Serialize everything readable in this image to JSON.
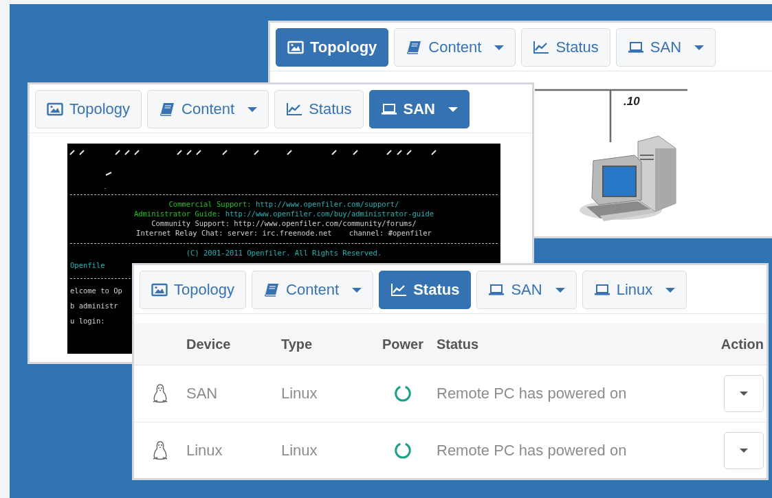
{
  "windows": [
    {
      "kind": "topology",
      "tabs": [
        {
          "label": "Topology",
          "kind": "image",
          "dropdown": false,
          "selected": true
        },
        {
          "label": "Content",
          "kind": "book",
          "dropdown": true,
          "selected": false
        },
        {
          "label": "Status",
          "kind": "chart",
          "dropdown": false,
          "selected": false
        },
        {
          "label": "SAN",
          "kind": "laptop",
          "dropdown": true,
          "selected": false
        }
      ],
      "topology": {
        "address": ".10"
      }
    },
    {
      "kind": "terminal",
      "tabs": [
        {
          "label": "Topology",
          "kind": "image",
          "dropdown": false,
          "selected": false
        },
        {
          "label": "Content",
          "kind": "book",
          "dropdown": true,
          "selected": false
        },
        {
          "label": "Status",
          "kind": "chart",
          "dropdown": false,
          "selected": false
        },
        {
          "label": "SAN",
          "kind": "laptop",
          "dropdown": true,
          "selected": true
        }
      ],
      "terminal": {
        "lines": [
          {
            "kind": "art"
          },
          {
            "kind": "rule"
          },
          {
            "kind": "center",
            "segments": [
              {
                "text": "Commercial Support: ",
                "color": "#22c322"
              },
              {
                "text": "http://www.openfiler.com/support/",
                "color": "#22b5b5"
              }
            ]
          },
          {
            "kind": "center",
            "segments": [
              {
                "text": "Administrator Guide: ",
                "color": "#22c322"
              },
              {
                "text": "http://www.openfiler.com/buy/administrator-guide",
                "color": "#22b5b5"
              }
            ]
          },
          {
            "kind": "center",
            "segments": [
              {
                "text": "Community Support: http://www.openfiler.com/community/forums/",
                "color": "#d0d0d0"
              }
            ]
          },
          {
            "kind": "center",
            "segments": [
              {
                "text": "Internet Relay Chat: server: irc.freenode.net    channel: #openfiler",
                "color": "#d0d0d0"
              }
            ]
          },
          {
            "kind": "rule"
          },
          {
            "kind": "center",
            "segments": [
              {
                "text": "(C) 2001-2011 Openfiler. All Rights Reserved.",
                "color": "#22b5b5"
              }
            ]
          },
          {
            "kind": "left",
            "segments": [
              {
                "text": "Openfile",
                "color": "#22b5b5"
              }
            ]
          },
          {
            "kind": "rule"
          },
          {
            "kind": "left",
            "segments": [
              {
                "text": "elcome to Op",
                "color": "#d0d0d0"
              }
            ]
          },
          {
            "kind": "left",
            "segments": [
              {
                "text": "b administr",
                "color": "#d0d0d0"
              }
            ]
          },
          {
            "kind": "left",
            "segments": [
              {
                "text": "u login:",
                "color": "#d0d0d0"
              }
            ]
          }
        ]
      }
    },
    {
      "kind": "devices",
      "tabs": [
        {
          "label": "Topology",
          "kind": "image",
          "dropdown": false,
          "selected": false
        },
        {
          "label": "Content",
          "kind": "book",
          "dropdown": true,
          "selected": false
        },
        {
          "label": "Status",
          "kind": "chart",
          "dropdown": false,
          "selected": true
        },
        {
          "label": "SAN",
          "kind": "laptop",
          "dropdown": true,
          "selected": false
        },
        {
          "label": "Linux",
          "kind": "laptop",
          "dropdown": true,
          "selected": false
        }
      ],
      "table": {
        "columns": [
          "Device",
          "Type",
          "Power",
          "Status",
          "Action"
        ],
        "rows": [
          {
            "device": "SAN",
            "type": "Linux",
            "status": "Remote PC has powered on"
          },
          {
            "device": "Linux",
            "type": "Linux",
            "status": "Remote PC has powered on"
          }
        ]
      }
    }
  ]
}
